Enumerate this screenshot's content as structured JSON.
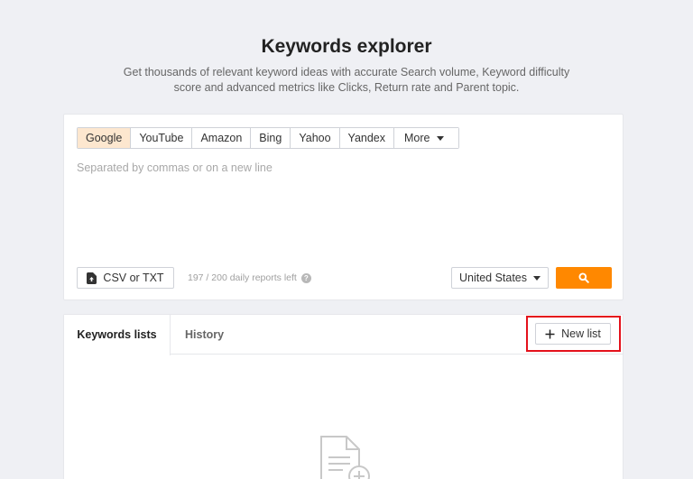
{
  "header": {
    "title": "Keywords explorer",
    "subtitle_line1": "Get thousands of relevant keyword ideas with accurate Search volume, Keyword difficulty",
    "subtitle_line2": "score and advanced metrics like Clicks, Return rate and Parent topic."
  },
  "engines": {
    "items": [
      "Google",
      "YouTube",
      "Amazon",
      "Bing",
      "Yahoo",
      "Yandex"
    ],
    "active": "Google",
    "more_label": "More"
  },
  "keywords_input": {
    "placeholder": "Separated by commas or on a new line",
    "value": ""
  },
  "upload": {
    "label": "CSV or TXT",
    "icon": "upload-file-icon"
  },
  "reports": {
    "text": "197 / 200 daily reports left",
    "icon": "help-icon"
  },
  "country": {
    "selected": "United States"
  },
  "search": {
    "icon": "search-icon",
    "color": "#ff8800"
  },
  "lists": {
    "tabs": [
      "Keywords lists",
      "History"
    ],
    "active_tab": "Keywords lists",
    "new_list_label": "New list",
    "highlight_color": "#e4111b",
    "empty_icon": "document-add-icon"
  }
}
